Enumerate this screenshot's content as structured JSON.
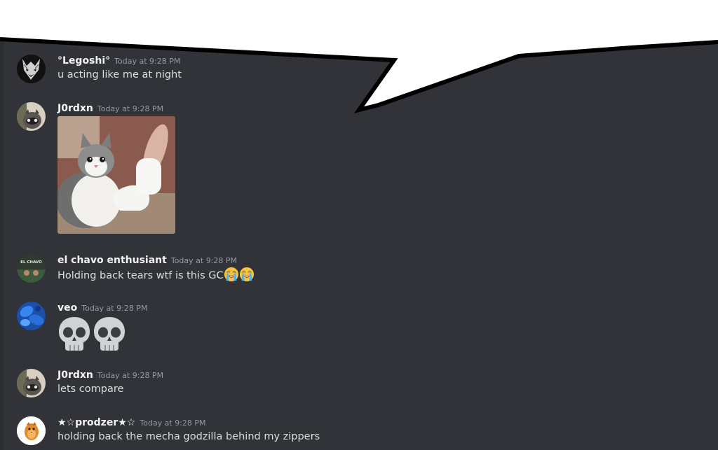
{
  "messages": [
    {
      "username": "°Legoshi°",
      "timestamp": "Today at 9:28 PM",
      "text": "u acting like me at night",
      "avatar_icon": "wolf-avatar-icon"
    },
    {
      "username": "J0rdxn",
      "timestamp": "Today at 9:28 PM",
      "text": "",
      "attachment": "cat-thumbs-up-image",
      "avatar_icon": "raccoon-avatar-icon"
    },
    {
      "username": "el chavo enthusiant",
      "timestamp": "Today at 9:28 PM",
      "text": "Holding back tears wtf is this GC",
      "emojis": [
        "loudly-crying-face-emoji",
        "loudly-crying-face-emoji"
      ],
      "avatar_icon": "el-chavo-avatar-icon",
      "avatar_text": "EL CHAVO"
    },
    {
      "username": "veo",
      "timestamp": "Today at 9:28 PM",
      "text": "",
      "emojis": [
        "skull-emoji",
        "skull-emoji"
      ],
      "avatar_icon": "blue-abstract-avatar-icon"
    },
    {
      "username": "J0rdxn",
      "timestamp": "Today at 9:28 PM",
      "text": "lets compare",
      "avatar_icon": "raccoon-avatar-icon"
    },
    {
      "username": "★☆prodzer★☆",
      "timestamp": "Today at 9:28 PM",
      "text": "holding back the mecha godzilla behind my zippers",
      "avatar_icon": "orange-character-avatar-icon"
    }
  ],
  "colors": {
    "background": "#313338",
    "username": "#f2f3f5",
    "timestamp": "#949ba4",
    "message_text": "#dbdee1",
    "speech_bubble": "#ffffff"
  }
}
